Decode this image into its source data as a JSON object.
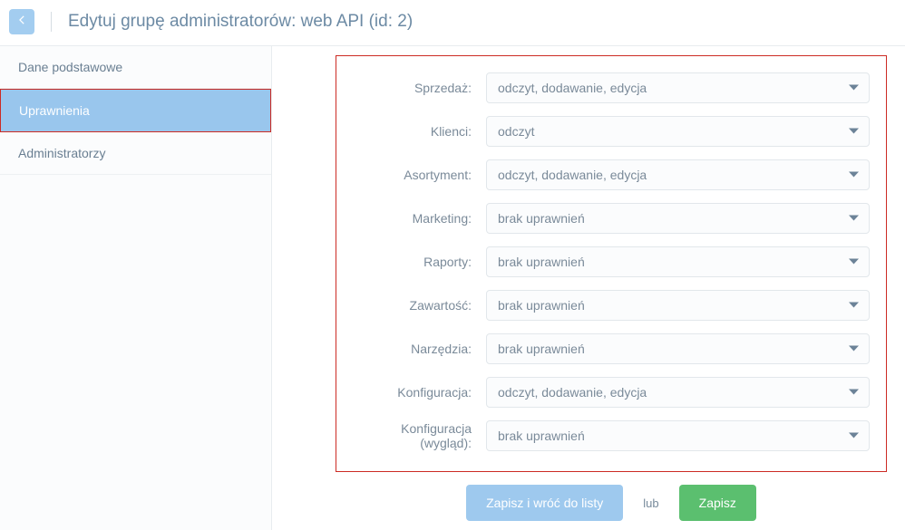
{
  "header": {
    "title": "Edytuj grupę administratorów: web API (id: 2)"
  },
  "sidebar": {
    "items": [
      {
        "label": "Dane podstawowe",
        "active": false
      },
      {
        "label": "Uprawnienia",
        "active": true
      },
      {
        "label": "Administratorzy",
        "active": false
      }
    ]
  },
  "form": {
    "rows": [
      {
        "label": "Sprzedaż:",
        "value": "odczyt, dodawanie, edycja"
      },
      {
        "label": "Klienci:",
        "value": "odczyt"
      },
      {
        "label": "Asortyment:",
        "value": "odczyt, dodawanie, edycja"
      },
      {
        "label": "Marketing:",
        "value": "brak uprawnień"
      },
      {
        "label": "Raporty:",
        "value": "brak uprawnień"
      },
      {
        "label": "Zawartość:",
        "value": "brak uprawnień"
      },
      {
        "label": "Narzędzia:",
        "value": "brak uprawnień"
      },
      {
        "label": "Konfiguracja:",
        "value": "odczyt, dodawanie, edycja"
      },
      {
        "label": "Konfiguracja (wygląd):",
        "value": "brak uprawnień"
      }
    ]
  },
  "actions": {
    "save_return": "Zapisz i wróć do listy",
    "or": "lub",
    "save": "Zapisz"
  }
}
